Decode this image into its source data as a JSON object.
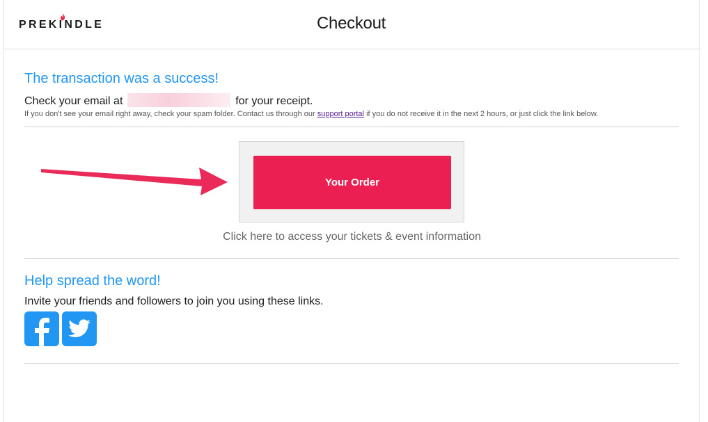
{
  "header": {
    "logo_text": "PREKINDLE",
    "title": "Checkout"
  },
  "confirmation": {
    "heading": "The transaction was a success!",
    "email_prefix": "Check your email at",
    "email_suffix": "for your receipt.",
    "fineprint_before": "If you don't see your email right away, check your spam folder. Contact us through our",
    "support_link": "support portal",
    "fineprint_after": "if you do not receive it in the next 2 hours, or just click the link below."
  },
  "order": {
    "button_label": "Your Order",
    "access_text": "Click here to access your tickets & event information"
  },
  "share": {
    "heading": "Help spread the word!",
    "invite_text": "Invite your friends and followers to join you using these links.",
    "icons": [
      "facebook-icon",
      "twitter-icon"
    ]
  },
  "colors": {
    "accent_blue": "#2196f3",
    "button_red": "#ec1f52",
    "arrow_red": "#ea2b5a",
    "flame": "#e8334a"
  }
}
